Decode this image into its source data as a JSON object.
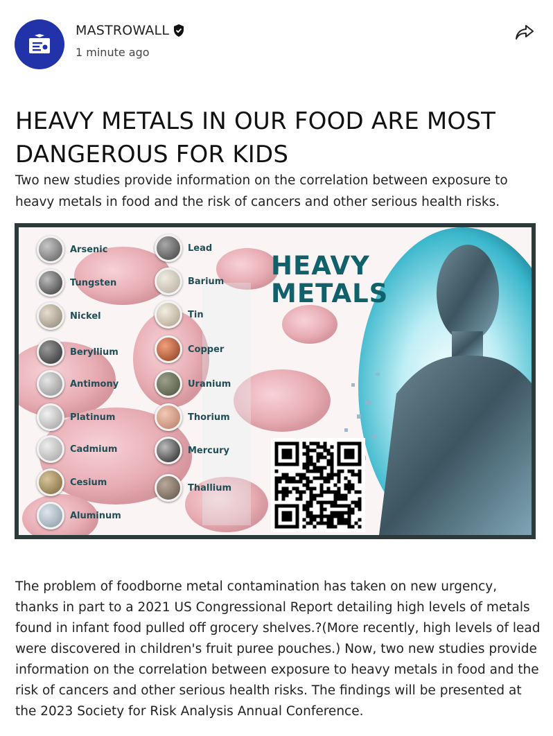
{
  "post": {
    "author": "MASTROWALL",
    "time": "1 minute ago",
    "title": "HEAVY METALS IN OUR FOOD ARE MOST DANGEROUS FOR KIDS",
    "subtitle": "Two new studies provide information on the correlation between exposure to heavy metals in food and the risk of cancers and other serious health risks.",
    "body": "The problem of foodborne metal contamination has taken on new urgency, thanks in part to a 2021 US Congressional Report detailing high levels of metals found in infant food pulled off grocery shelves.?(More recently, high levels of lead were discovered in children's fruit puree pouches.) Now, two new studies provide information on the correlation between exposure to heavy metals in food and the risk of cancers and other serious health risks. The findings will be presented at the 2023 Society for Risk Analysis Annual Conference."
  },
  "icons": {
    "avatar": "certificate-icon",
    "verified": "shield-badge-icon",
    "share": "share-arrow-icon"
  },
  "hero": {
    "heading_line1": "HEAVY",
    "heading_line2": "METALS",
    "metals_left": [
      "Arsenic",
      "Tungsten",
      "Nickel",
      "Beryllium",
      "Antimony",
      "Platinum",
      "Cadmium",
      "Cesium",
      "Aluminum"
    ],
    "metals_right": [
      "Lead",
      "Barium",
      "Tin",
      "Copper",
      "Uranium",
      "Thorium",
      "Mercury",
      "Thallium"
    ]
  },
  "colors": {
    "avatar_bg": "#2233aa",
    "heading_teal": "#10616a"
  }
}
